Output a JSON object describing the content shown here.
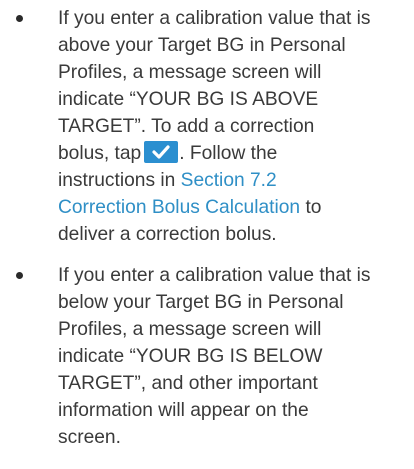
{
  "bullets": [
    {
      "lines": [
        "If you enter a calibration value that is",
        "above your Target BG in Personal",
        "Profiles, a message screen will",
        "indicate “YOUR BG IS ABOVE",
        "TARGET”. To add a correction"
      ],
      "tap_line_before": "bolus, tap",
      "tap_line_after": ". Follow the",
      "instructions_line": "instructions in",
      "link_part1": "Section 7.2",
      "link_part2": "Correction Bolus Calculation",
      "after_link": "to",
      "last_line": "deliver a correction bolus."
    },
    {
      "lines": [
        "If you enter a calibration value that is",
        "below your Target BG in Personal",
        "Profiles, a message screen will",
        "indicate “YOUR BG IS BELOW",
        "TARGET”, and other important",
        "information will appear on the",
        "screen."
      ]
    }
  ],
  "colors": {
    "text": "#3a3a3a",
    "link": "#2f8fc6",
    "button": "#2b8fd0"
  },
  "icons": {
    "tap_button": "checkmark-icon"
  }
}
